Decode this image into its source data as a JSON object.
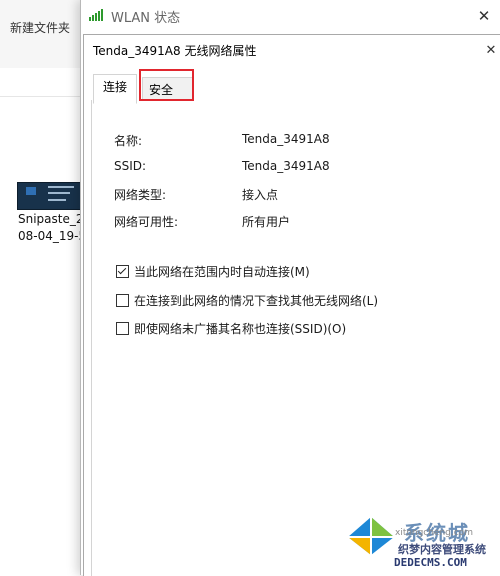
{
  "explorer": {
    "new_folder_label": "新建文件夹",
    "file": {
      "name_line1": "Snipaste_2",
      "name_line2": "08-04_19-5"
    }
  },
  "wlan_window": {
    "title": "WLAN 状态",
    "close_symbol": "✕"
  },
  "properties_dialog": {
    "title": "Tenda_3491A8 无线网络属性",
    "close_symbol": "✕",
    "tabs": [
      {
        "label": "连接",
        "selected": true
      },
      {
        "label": "安全",
        "selected": false
      }
    ],
    "info": [
      {
        "label": "名称:",
        "value": "Tenda_3491A8"
      },
      {
        "label": "SSID:",
        "value": "Tenda_3491A8"
      },
      {
        "label": "网络类型:",
        "value": "接入点"
      },
      {
        "label": "网络可用性:",
        "value": "所有用户"
      }
    ],
    "options": [
      {
        "label": "当此网络在范围内时自动连接(M)",
        "checked": true
      },
      {
        "label": "在连接到此网络的情况下查找其他无线网络(L)",
        "checked": false
      },
      {
        "label": "即使网络未广播其名称也连接(SSID)(O)",
        "checked": false
      }
    ]
  },
  "watermark": {
    "brand_cn": "系统城",
    "small": "xitongcheng.com",
    "site_cn": "织梦内容管理系统",
    "site_en": "DEDECMS.COM"
  },
  "colors": {
    "highlight": "#e1262e",
    "signal": "#2e9a2e"
  }
}
